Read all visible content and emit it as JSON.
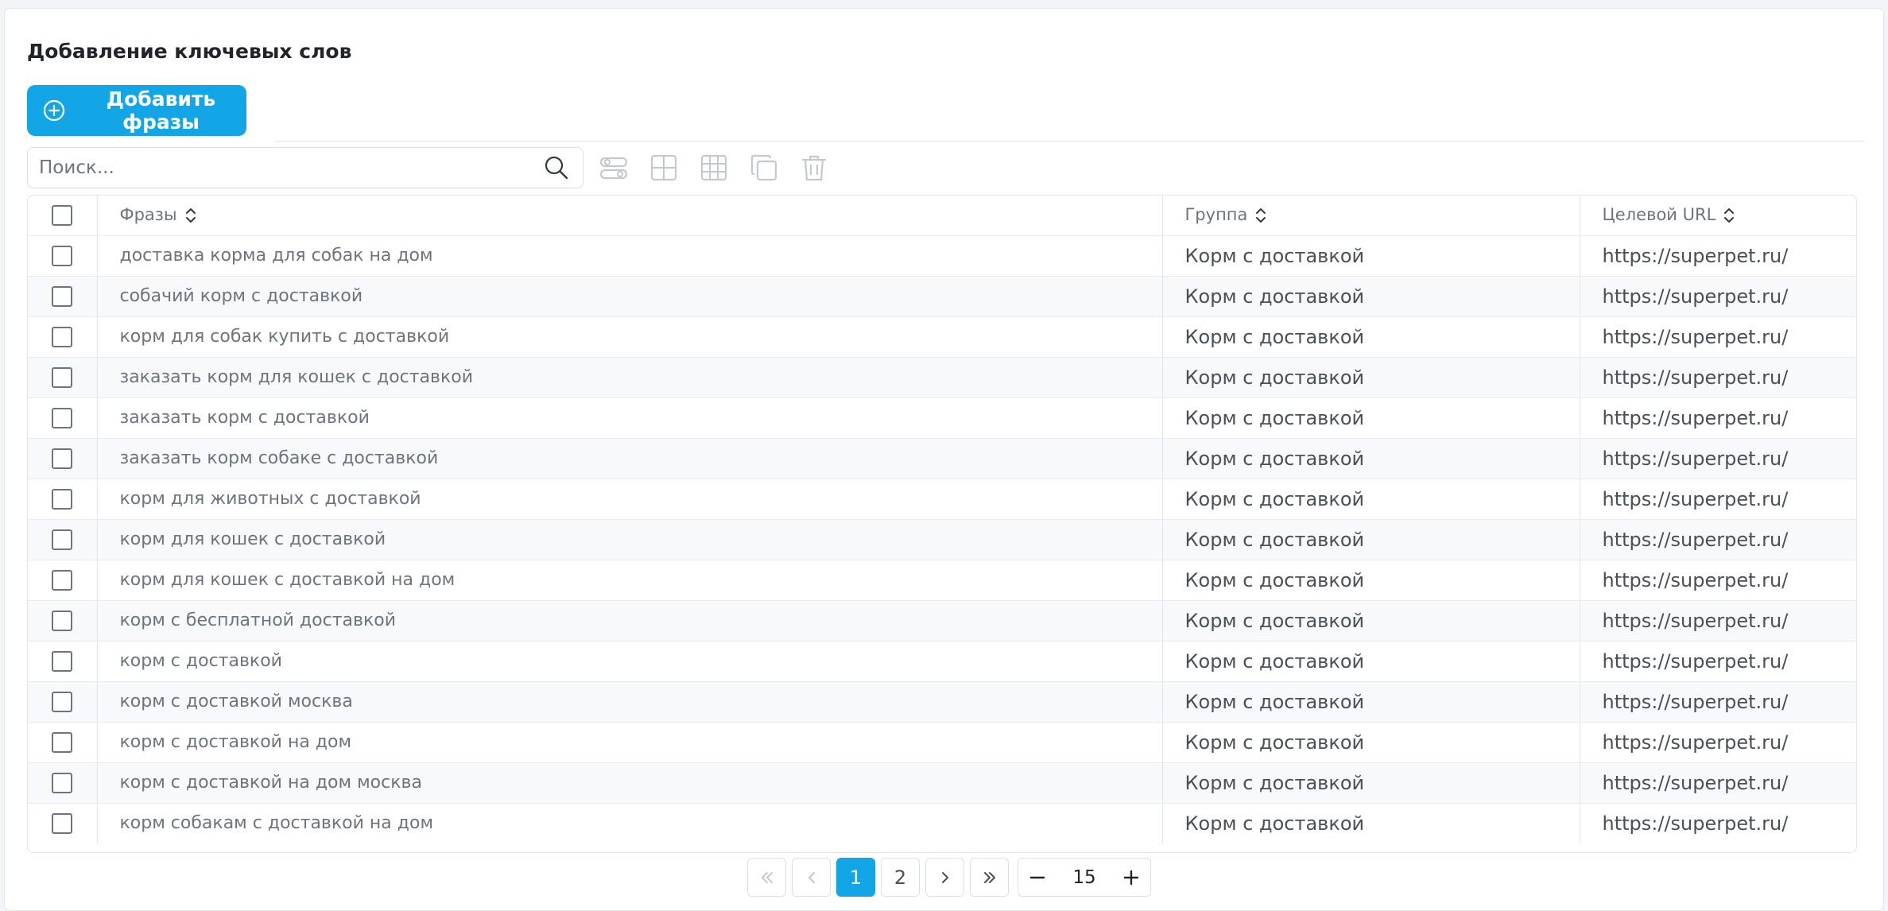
{
  "page": {
    "title": "Добавление ключевых слов"
  },
  "toolbar": {
    "add_label": "Добавить фразы",
    "search_placeholder": "Поиск..."
  },
  "table": {
    "headers": {
      "phrase": "Фразы",
      "group": "Группа",
      "url": "Целевой URL"
    },
    "rows": [
      {
        "phrase": "доставка корма для собак на дом",
        "group": "Корм с доставкой",
        "url": "https://superpet.ru/"
      },
      {
        "phrase": "собачий корм с доставкой",
        "group": "Корм с доставкой",
        "url": "https://superpet.ru/"
      },
      {
        "phrase": "корм для собак купить с доставкой",
        "group": "Корм с доставкой",
        "url": "https://superpet.ru/"
      },
      {
        "phrase": "заказать корм для кошек с доставкой",
        "group": "Корм с доставкой",
        "url": "https://superpet.ru/"
      },
      {
        "phrase": "заказать корм с доставкой",
        "group": "Корм с доставкой",
        "url": "https://superpet.ru/"
      },
      {
        "phrase": "заказать корм собаке с доставкой",
        "group": "Корм с доставкой",
        "url": "https://superpet.ru/"
      },
      {
        "phrase": "корм для животных с доставкой",
        "group": "Корм с доставкой",
        "url": "https://superpet.ru/"
      },
      {
        "phrase": "корм для кошек с доставкой",
        "group": "Корм с доставкой",
        "url": "https://superpet.ru/"
      },
      {
        "phrase": "корм для кошек с доставкой на дом",
        "group": "Корм с доставкой",
        "url": "https://superpet.ru/"
      },
      {
        "phrase": "корм с бесплатной доставкой",
        "group": "Корм с доставкой",
        "url": "https://superpet.ru/"
      },
      {
        "phrase": "корм с доставкой",
        "group": "Корм с доставкой",
        "url": "https://superpet.ru/"
      },
      {
        "phrase": "корм с доставкой москва",
        "group": "Корм с доставкой",
        "url": "https://superpet.ru/"
      },
      {
        "phrase": "корм с доставкой на дом",
        "group": "Корм с доставкой",
        "url": "https://superpet.ru/"
      },
      {
        "phrase": "корм с доставкой на дом москва",
        "group": "Корм с доставкой",
        "url": "https://superpet.ru/"
      },
      {
        "phrase": "корм собакам с доставкой на дом",
        "group": "Корм с доставкой",
        "url": "https://superpet.ru/"
      }
    ]
  },
  "pagination": {
    "pages": [
      "1",
      "2"
    ],
    "current_page": "1",
    "page_size": "15"
  },
  "colors": {
    "accent": "#12a6e6",
    "icon_muted": "#c4c8cf"
  }
}
